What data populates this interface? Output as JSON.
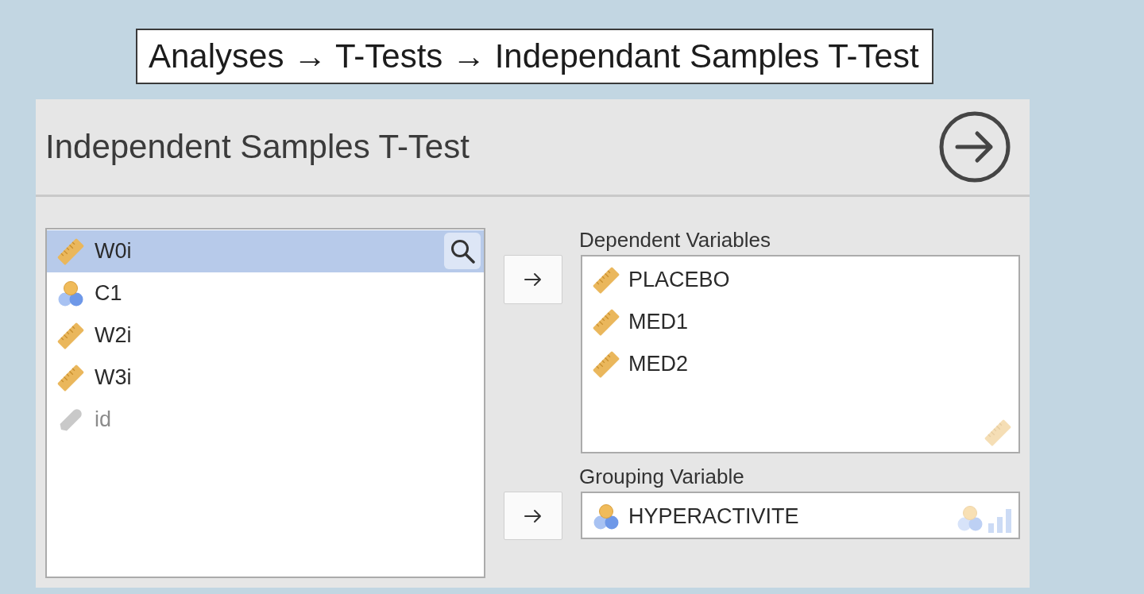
{
  "breadcrumb": "Analyses → T-Tests → Independant Samples T-Test",
  "title": "Independent Samples T-Test",
  "variables": [
    {
      "name": "W0i",
      "kind": "scale",
      "selected": true
    },
    {
      "name": "C1",
      "kind": "nominal",
      "selected": false
    },
    {
      "name": "W2i",
      "kind": "scale",
      "selected": false
    },
    {
      "name": "W3i",
      "kind": "scale",
      "selected": false
    },
    {
      "name": "id",
      "kind": "id",
      "selected": false
    }
  ],
  "dependent_variables": {
    "label": "Dependent Variables",
    "items": [
      {
        "name": "PLACEBO",
        "kind": "scale"
      },
      {
        "name": "MED1",
        "kind": "scale"
      },
      {
        "name": "MED2",
        "kind": "scale"
      }
    ],
    "accepted_types": [
      {
        "kind": "scale"
      }
    ]
  },
  "grouping_variable": {
    "label": "Grouping Variable",
    "items": [
      {
        "name": "HYPERACTIVITE",
        "kind": "nominal"
      }
    ],
    "accepted_types": [
      {
        "kind": "nominal"
      },
      {
        "kind": "ordinal"
      }
    ]
  }
}
